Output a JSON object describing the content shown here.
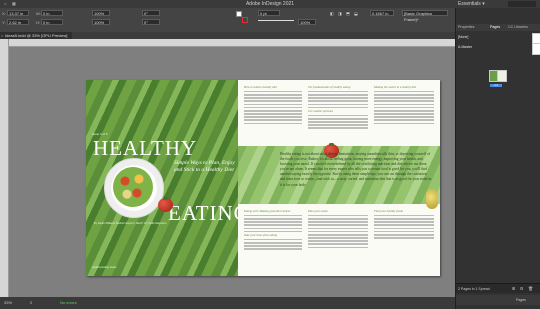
{
  "app": {
    "title": "Adobe InDesign 2021",
    "workspace": "Essentials",
    "workspace_chevron": "▾",
    "search_icon": "⌕"
  },
  "control_bar": {
    "x_label": "X:",
    "x_value": "13.37 in",
    "y_label": "Y:",
    "y_value": "2.62 in",
    "w_label": "W:",
    "w_value": "0 in",
    "h_label": "H:",
    "h_value": "0 in",
    "scale_x": "100%",
    "scale_y": "100%",
    "rotation": "0°",
    "shear": "0°",
    "stroke_weight": "0 pt",
    "stroke_zoom": "100%",
    "tint": "0.1667 in",
    "frame_style": "[Basic Graphics Frame]+",
    "fill_icon": "◼",
    "align_icons": [
      "◧",
      "◨",
      "⬒",
      "⬓"
    ]
  },
  "document_tab": {
    "label": "Ideas5.indd @ 33% [GPU Preview]",
    "close_icon": "×"
  },
  "layout": {
    "healthy": "HEALTHY",
    "eating": "EATING",
    "kicker": "Issue 3 of 5",
    "subhead": "Simple Ways to Plan, Enjoy and Stick to a Healthy Diet",
    "caption": "By Sarah Williams Nutrition Expert | March 12 | Hello Magazine",
    "footer": "Healthy Eating Guide",
    "big_paragraph": "Healthy eating is not about strict dietary limitations, staying unrealistically thin, or depriving yourself of the foods you love. Rather, it's about feeling great, having more energy, improving your health, and boosting your mood. If you feel overwhelmed by all the conflicting nutrition and diet advice out there, you're not alone. It seems that for every expert who tells you a certain food is good for you, you'll find another saying exactly the opposite. But by using these simple tips, you can cut through the confusion and learn how to create—and stick to—a tasty, varied, and nutritious diet that is as good for your mind as it is for your body.",
    "column_heads": [
      "How to build a healthy diet",
      "The fundamentals of healthy eating",
      "Eating well: Making good diet choices",
      "Making the switch to a healthy diet",
      "Use smaller portions",
      "Take your time when eating",
      "Plan your meals",
      "Find your healthy foods"
    ]
  },
  "panels": {
    "tabs": [
      "Properties",
      "Pages",
      "CC Libraries"
    ],
    "none_label": "[None]",
    "master_label": "A-Master",
    "spread_label": "2-3",
    "status": "2 Pages in 1 Spread",
    "footer_label": "Pages",
    "footer_icons": [
      "⊞",
      "⊟",
      "🗑"
    ]
  },
  "statusbar": {
    "zoom": "33%",
    "page": "2",
    "preflight": "No errors"
  }
}
